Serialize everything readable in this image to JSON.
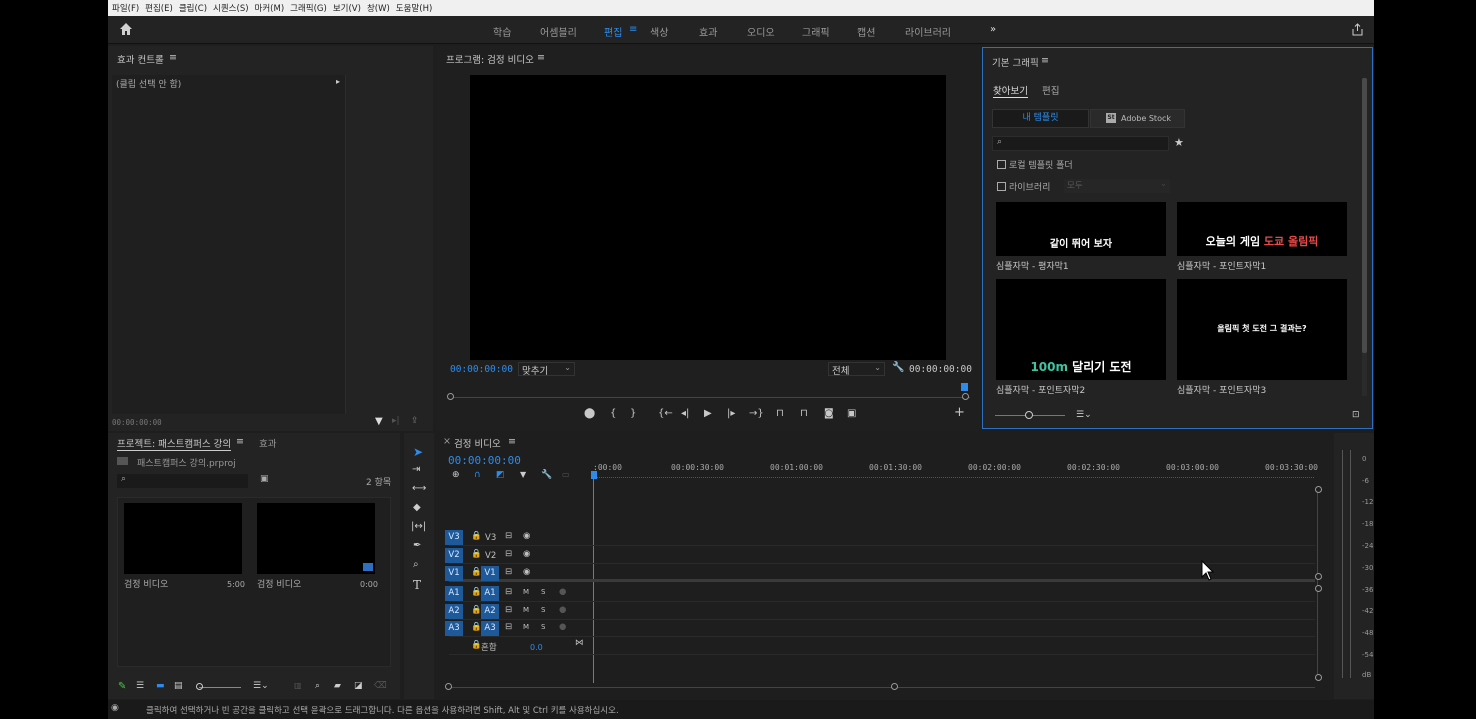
{
  "menu": [
    "파일(F)",
    "편집(E)",
    "클립(C)",
    "시퀀스(S)",
    "마커(M)",
    "그래픽(G)",
    "보기(V)",
    "창(W)",
    "도움말(H)"
  ],
  "workspaces": {
    "learn": "학습",
    "assembly": "어셈블리",
    "edit": "편집",
    "color": "색상",
    "effects": "효과",
    "audio": "오디오",
    "graphics": "그래픽",
    "captions": "캡션",
    "libraries": "라이브러리",
    "more": "»"
  },
  "effect_controls": {
    "title": "효과 컨트롤",
    "menu": "≡",
    "no_clip": "(클립 선택 안 함)",
    "timecode": "00:00:00:00"
  },
  "program": {
    "title": "프로그램: 검정 비디오",
    "menu": "≡",
    "timecode": "00:00:00:00",
    "fit": "맞추기",
    "quality": "전체",
    "duration": "00:00:00:00"
  },
  "essential_graphics": {
    "title": "기본 그래픽",
    "menu": "≡",
    "tab_browse": "찾아보기",
    "tab_edit": "편집",
    "my_templates": "내 템플릿",
    "adobe_stock": "Adobe Stock",
    "local_templates": "로컬 템플릿 폴더",
    "libraries": "라이브러리",
    "libraries_select": "모두",
    "templates": [
      {
        "caption": "심플자막 - 평자막1",
        "text1": "같이 뛰어 보자",
        "text2": "",
        "color2": "#ffffff"
      },
      {
        "caption": "심플자막 - 포인트자막1",
        "text1": "오늘의 게임 ",
        "text2": "도쿄 올림픽",
        "color2": "#e84a4a"
      },
      {
        "caption": "심플자막 - 포인트자막2",
        "text1": "100m",
        "text2": " 달리기 도전",
        "color2": "#ffffff"
      },
      {
        "caption": "심플자막 - 포인트자막3",
        "text1": "올림픽 첫 도전 그 결과는?",
        "text2": "",
        "color2": "#ffffff"
      }
    ]
  },
  "project": {
    "title": "프로젝트: 패스트캠퍼스 강의",
    "menu": "≡",
    "tab_effects": "효과",
    "file": "패스트캠퍼스 강의.prproj",
    "count": "2 항목",
    "items": [
      {
        "name": "검정 비디오",
        "duration": "5:00"
      },
      {
        "name": "검정 비디오",
        "duration": "0:00"
      }
    ]
  },
  "timeline": {
    "close": "×",
    "title": "검정 비디오",
    "menu": "≡",
    "timecode": "00:00:00:00",
    "ruler": [
      ":00:00",
      "00:00:30:00",
      "00:01:00:00",
      "00:01:30:00",
      "00:02:00:00",
      "00:02:30:00",
      "00:03:00:00",
      "00:03:30:00"
    ],
    "video_tracks": [
      "V3",
      "V2",
      "V1"
    ],
    "audio_tracks": [
      "A3",
      "A2",
      "A1"
    ],
    "mix_label": "혼합",
    "mix_value": "0.0"
  },
  "meter_scale": [
    "0",
    "-6",
    "-12",
    "-18",
    "-24",
    "-30",
    "-36",
    "-42",
    "-48",
    "-54",
    "dB"
  ],
  "status": "클릭하여 선택하거나 빈 공간을 클릭하고 선택 윤곽으로 드래그합니다. 다른 옵션을 사용하려면 Shift, Alt 및 Ctrl 키를 사용하십시오.",
  "colors": {
    "accent": "#2d8ceb",
    "track_blue": "#1e5a9a",
    "panel": "#232323",
    "bg": "#1e1e1e"
  }
}
